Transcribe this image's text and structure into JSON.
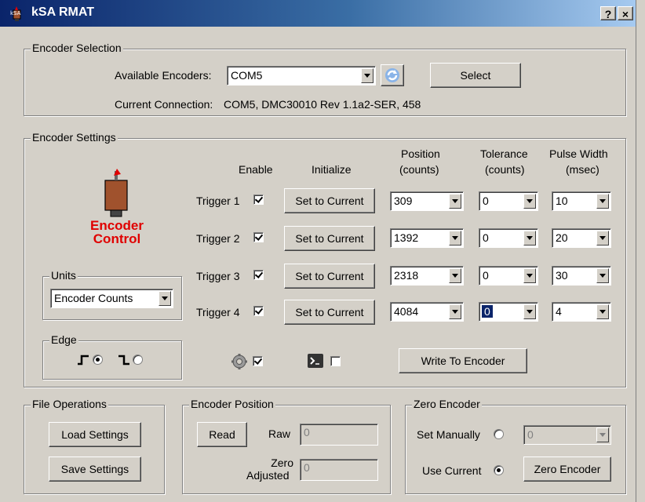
{
  "window": {
    "title": "kSA RMAT",
    "help_glyph": "?",
    "close_glyph": "×"
  },
  "encoder_selection": {
    "legend": "Encoder Selection",
    "available_label": "Available Encoders:",
    "available_value": "COM5",
    "select_label": "Select",
    "connection_label": "Current Connection:",
    "connection_value": "COM5, DMC30010 Rev 1.1a2-SER, 458"
  },
  "encoder_settings": {
    "legend": "Encoder Settings",
    "headers": {
      "enable": "Enable",
      "initialize": "Initialize",
      "position_1": "Position",
      "position_2": "(counts)",
      "tolerance_1": "Tolerance",
      "tolerance_2": "(counts)",
      "pulse_1": "Pulse Width",
      "pulse_2": "(msec)"
    },
    "logo_text_1": "Encoder",
    "logo_text_2": "Control",
    "set_label": "Set to Current",
    "triggers": [
      {
        "label": "Trigger 1",
        "enabled": true,
        "position": "309",
        "tolerance": "0",
        "pulse": "10"
      },
      {
        "label": "Trigger 2",
        "enabled": true,
        "position": "1392",
        "tolerance": "0",
        "pulse": "20"
      },
      {
        "label": "Trigger 3",
        "enabled": true,
        "position": "2318",
        "tolerance": "0",
        "pulse": "30"
      },
      {
        "label": "Trigger 4",
        "enabled": true,
        "position": "4084",
        "tolerance": "0",
        "pulse": "4"
      }
    ],
    "units": {
      "legend": "Units",
      "value": "Encoder Counts"
    },
    "edge": {
      "legend": "Edge",
      "selected": "rising"
    },
    "gear_checked": true,
    "console_checked": false,
    "write_label": "Write To Encoder"
  },
  "file_ops": {
    "legend": "File Operations",
    "load_label": "Load Settings",
    "save_label": "Save Settings"
  },
  "encoder_position": {
    "legend": "Encoder Position",
    "read_label": "Read",
    "raw_label": "Raw",
    "raw_value": "0",
    "zero_label_1": "Zero",
    "zero_label_2": "Adjusted",
    "zero_value": "0"
  },
  "zero_encoder": {
    "legend": "Zero Encoder",
    "manual_label": "Set Manually",
    "manual_value": "0",
    "current_label": "Use Current",
    "selected": "use_current",
    "zero_button_label": "Zero Encoder"
  },
  "colors": {
    "title_start": "#0a246a",
    "title_end": "#a6caf0",
    "logo_red": "#e00000",
    "face": "#d4d0c8"
  }
}
